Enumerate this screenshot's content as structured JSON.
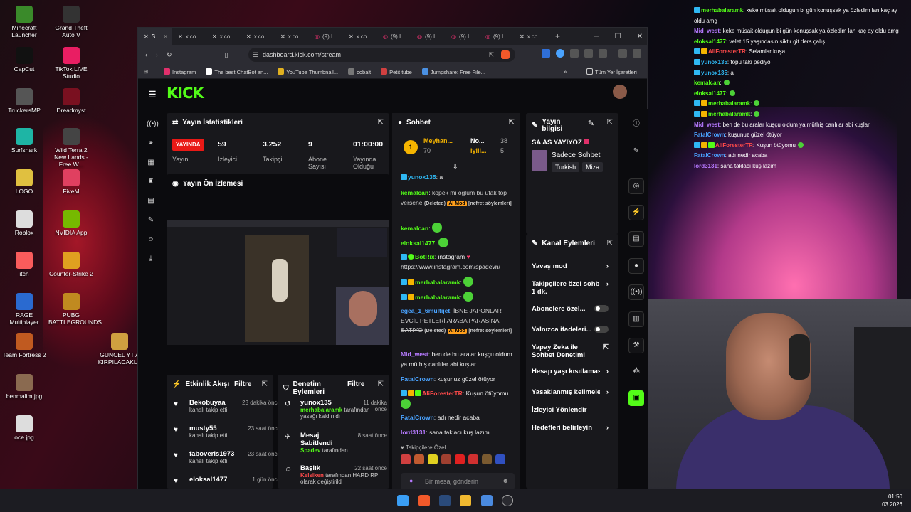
{
  "desktop": {
    "icons": [
      {
        "label": "Minecraft Launcher",
        "color": "#3a8a2a"
      },
      {
        "label": "Grand Theft Auto V",
        "color": "#333"
      },
      {
        "label": "CapCut",
        "color": "#111"
      },
      {
        "label": "TikTok LIVE Studio",
        "color": "#e91e63"
      },
      {
        "label": "TruckersMP",
        "color": "#555"
      },
      {
        "label": "Dreadmyst",
        "color": "#7a1020"
      },
      {
        "label": "Surfshark",
        "color": "#1eb5a5"
      },
      {
        "label": "Wild Terra 2 New Lands - Free W...",
        "color": "#444"
      },
      {
        "label": "LOGO",
        "color": "#e0c040"
      },
      {
        "label": "FiveM",
        "color": "#e04060"
      },
      {
        "label": "Roblox",
        "color": "#ddd"
      },
      {
        "label": "NVIDIA App",
        "color": "#76b900"
      },
      {
        "label": "itch",
        "color": "#fa5c5c"
      },
      {
        "label": "Counter-Strike 2",
        "color": "#e0a020"
      },
      {
        "label": "RAGE Multiplayer",
        "color": "#2a6ad0"
      },
      {
        "label": "PUBG BATTLEGROUNDS",
        "color": "#c08a20"
      },
      {
        "label": "Team Fortress 2",
        "color": "#c05a20"
      },
      {
        "label": "GUNCEL YT A KIRPILACAKLA",
        "color": "#d0a040"
      },
      {
        "label": "benmalim.jpg",
        "color": "#8a6a50"
      },
      {
        "label": "oce.jpg",
        "color": "#ddd"
      }
    ]
  },
  "overlay": {
    "messages": [
      {
        "name": "merhabalaramk",
        "text": ": keke müsait oldugun bi gün konuşsak ya özledim lan kaç ay oldu amg",
        "color": "#53fc18",
        "badges": 1
      },
      {
        "name": "Mid_west",
        "text": ": keke müsait oldugun bi gün konuşsak ya özledim lan kaç ay oldu amg",
        "color": "#b67aff",
        "badges": 0
      },
      {
        "name": "eloksal1477",
        "text": ": velet 15 yaşındasın siktir git ders çalış",
        "color": "#53fc18",
        "badges": 0
      },
      {
        "name": "AliForesterTR",
        "text": ": Selamlar kuşa",
        "color": "#ff4a4a",
        "badges": 2
      },
      {
        "name": "yunox135",
        "text": ": topu taki pediyo",
        "color": "#2fb8f3",
        "badges": 1
      },
      {
        "name": "yunox135",
        "text": ": a",
        "color": "#2fb8f3",
        "badges": 1
      },
      {
        "name": "kemalcan",
        "text": ":",
        "color": "#53fc18",
        "badges": 0
      },
      {
        "name": "eloksal1477",
        "text": ":",
        "color": "#53fc18",
        "badges": 0
      },
      {
        "name": "merhabalaramk",
        "text": ":",
        "color": "#53fc18",
        "badges": 2
      },
      {
        "name": "merhabalaramk",
        "text": ":",
        "color": "#53fc18",
        "badges": 2
      },
      {
        "name": "Mid_west",
        "text": ": ben de bu aralar kuşçu oldum ya müthiş canlılar abi kuşlar",
        "color": "#b67aff",
        "badges": 0
      },
      {
        "name": "FatalCrown",
        "text": ": kuşunuz güzel ötüyor",
        "color": "#4aa3ff",
        "badges": 0
      },
      {
        "name": "AliForesterTR",
        "text": ": Kuşun ötüyomu",
        "color": "#ff4a4a",
        "badges": 3
      },
      {
        "name": "FatalCrown",
        "text": ": adı nedir acaba",
        "color": "#4aa3ff",
        "badges": 0
      },
      {
        "name": "lord3131",
        "text": ": sana taklacı kuş lazım",
        "color": "#b67aff",
        "badges": 0
      }
    ]
  },
  "browser": {
    "tabs": [
      "S",
      "x.co",
      "x.co",
      "x.co",
      "x.co",
      "(9) I",
      "x.co",
      "(9) I",
      "(9) I",
      "(9) I",
      "(9) I",
      "x.co"
    ],
    "new_tab": "+",
    "url": "dashboard.kick.com/stream",
    "bookmarks": [
      {
        "label": "Instagram",
        "color": "#e1306c"
      },
      {
        "label": "The best ChatBot an...",
        "color": "#fff"
      },
      {
        "label": "YouTube Thumbnail...",
        "color": "#e0b020"
      },
      {
        "label": "cobalt",
        "color": "#777"
      },
      {
        "label": "Petit tube",
        "color": "#d04040"
      },
      {
        "label": "Jumpshare: Free File...",
        "color": "#4a90e2"
      }
    ],
    "all_bookmarks": "Tüm Yer İşaretleri",
    "more": "»"
  },
  "kick": {
    "logo": "KICK",
    "stats": {
      "title": "Yayın İstatistikleri",
      "live": "YAYINDA",
      "live_label": "Yayın",
      "viewers": "59",
      "viewers_label": "İzleyici",
      "followers": "3.252",
      "followers_label": "Takipçi",
      "subs": "9",
      "subs_label": "Abone Sayısı",
      "uptime": "01:00:00",
      "uptime_label": "Yayında Olduğu"
    },
    "preview_title": "Yayın Ön İzlemesi",
    "activity": {
      "title": "Etkinlik Akışı",
      "filter": "Filtre",
      "rows": [
        {
          "name": "Bekobuyaa",
          "time": "23 dakika önce",
          "sub": "kanalı takip etti"
        },
        {
          "name": "musty55",
          "time": "23 saat önce",
          "sub": "kanalı takip etti"
        },
        {
          "name": "faboveris1973",
          "time": "23 saat önce",
          "sub": "kanalı takip etti"
        },
        {
          "name": "eloksal1477",
          "time": "1 gün önce",
          "sub": ""
        }
      ]
    },
    "moderation": {
      "title": "Denetim Eylemleri",
      "filter": "Filtre",
      "rows": [
        {
          "name": "yunox135",
          "time": "11 dakika önce",
          "by": "merhabalaramk",
          "rest": "tarafından yasağı kaldırıldı"
        },
        {
          "name": "Mesaj Sabitlendi",
          "time": "8 saat önce",
          "by": "Spadev",
          "rest": "tarafından"
        },
        {
          "name": "Başlık",
          "time": "22 saat önce",
          "by": "Kelsiken",
          "rest": "tarafından HARD RP olarak değiştirildi"
        }
      ]
    },
    "chat": {
      "title": "Sohbet",
      "top1_name": "Meyhan...",
      "top1_val": "70",
      "top2_name": "No...",
      "top2_val": "38",
      "top3_name": "iyili...",
      "top3_val": "5",
      "rank": "1",
      "m1_user": "yunox135",
      "m1_text": ": a",
      "m2_user": "kemalcan",
      "m2_text": "köpek mi oğlum bu ufak top versene",
      "m2_deleted": "(Deleted)",
      "m2_mod": "AI Mod",
      "m2_tag": "[nefret söylemleri]",
      "m3_user": "kemalcan",
      "m4_user": "eloksal1477",
      "m5_user": "BotRix",
      "m5_text": ": instagram",
      "m5_link": "https://www.instagram.com/spadevn/",
      "m6_user": "merhabalaramk",
      "m7_user": "merhabalaramk",
      "m8_user": "egea_1_6multijet",
      "m8_text": "İBNE JAPONLAR EVCİL PETLERİ ARABA PARASINA SATIYO",
      "m8_deleted": "(Deleted)",
      "m8_mod": "AI Mod",
      "m8_tag": "[nefret söylemleri]",
      "m9_user": "Mid_west",
      "m9_text": ": ben de bu aralar kuşçu oldum ya müthiş canlılar abi kuşlar",
      "m10_user": "FatalCrown",
      "m10_text": ": kuşunuz güzel ötüyor",
      "m11_user": "AliForesterTR",
      "m11_text": ": Kuşun ötüyomu",
      "m12_user": "FatalCrown",
      "m12_text": ": adı nedir acaba",
      "m13_user": "lord3131",
      "m13_text": ": sana taklacı kuş lazım",
      "follower_special": "Takipçilere Özel",
      "placeholder": "Bir mesaj gönderin"
    },
    "info": {
      "title": "Yayın bilgisi",
      "stream_title": "SA AS YAYIYOZ",
      "category": "Sadece Sohbet",
      "tag1": "Turkish",
      "tag2": "Miza"
    },
    "actions": {
      "title": "Kanal Eylemleri",
      "slow": "Yavaş mod",
      "followers_only": "Takipçilere özel sohb",
      "followers_only_sub": "1 dk.",
      "subs_only": "Abonelere özel...",
      "emotes_only": "Yalnızca ifadeleri...",
      "ai_mod": "Yapay Zeka ile Sohbet Denetimi",
      "account_age": "Hesap yaşı kısıtlaması",
      "banned_words": "Yasaklanmış kelimele",
      "redirect": "İzleyici Yönlendir",
      "goals": "Hedefleri belirleyin"
    }
  },
  "taskbar": {
    "time": "01:50",
    "date": "03.2026"
  }
}
